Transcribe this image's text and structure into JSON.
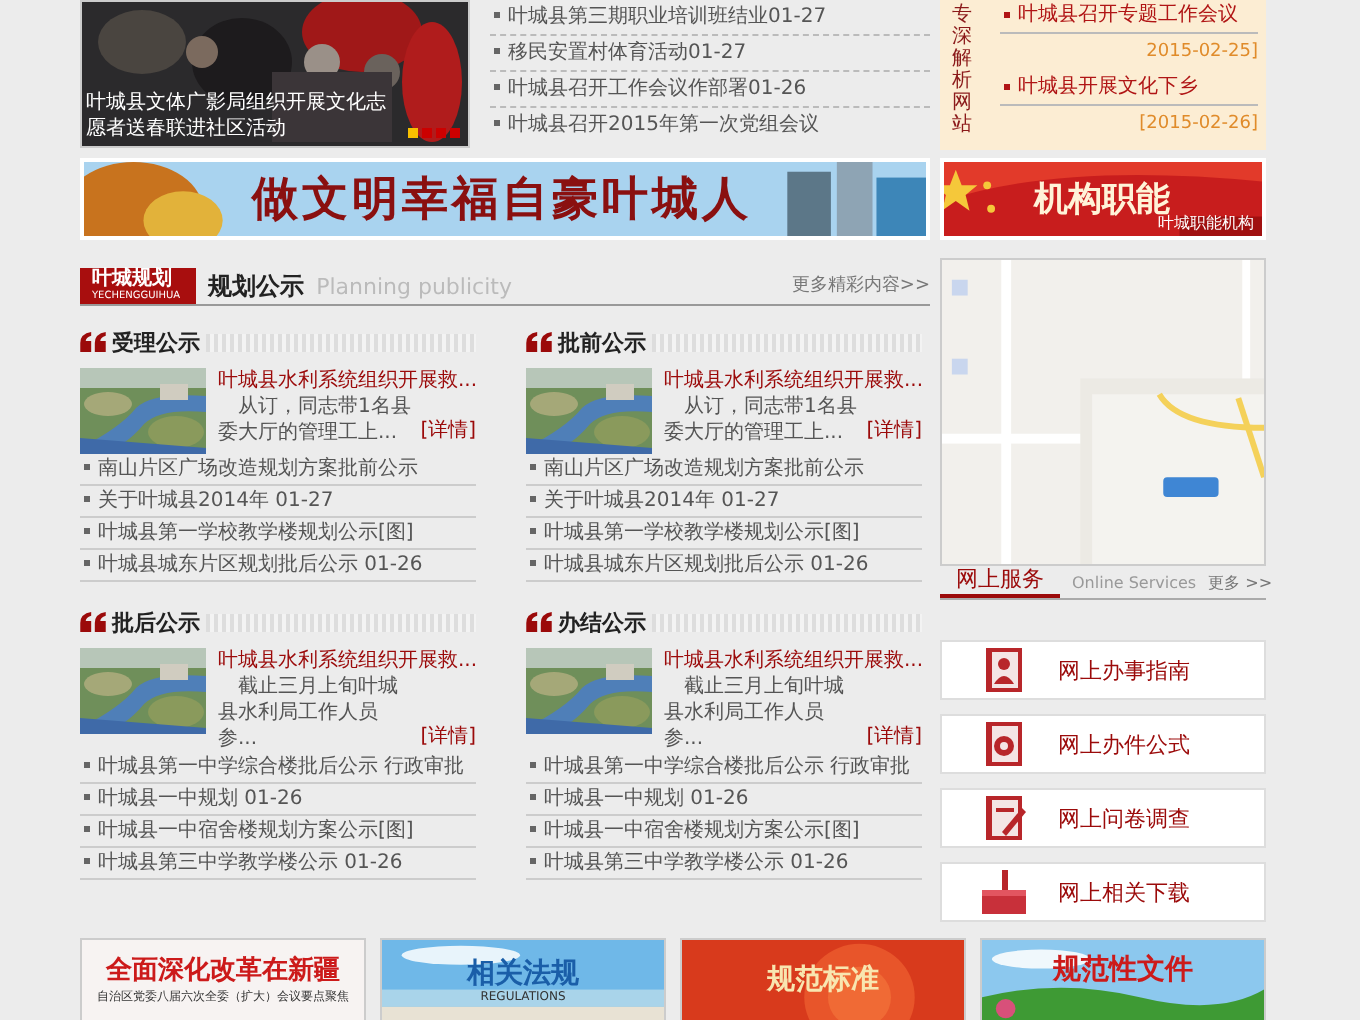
{
  "slideshow": {
    "caption": "叶城县文体广影局组织开展文化志愿者送春联进社区活动",
    "dots": [
      {
        "selected": true
      },
      {
        "selected": false
      },
      {
        "selected": false
      },
      {
        "selected": false
      }
    ]
  },
  "top_news": [
    {
      "title": "叶城县第三期职业培训班结业",
      "date": "01-27"
    },
    {
      "title": "移民安置村体育活动",
      "date": "01-27"
    },
    {
      "title": "叶城县召开工作会议作部署",
      "date": "01-26"
    },
    {
      "title": "叶城县召开2015年第一次党组会议"
    }
  ],
  "side_notice": {
    "vertical_title": "专深解析网站",
    "items": [
      {
        "title": "叶城县召开专题工作会议",
        "date": "2015-02-25]"
      },
      {
        "title": "叶城县开展文化下乡",
        "date": "[2015-02-26]"
      }
    ]
  },
  "banners": [
    {
      "kind": "civic",
      "text": "做文明幸福自豪叶城人"
    },
    {
      "kind": "flag",
      "text": "机构职能",
      "subtext": "叶城职能机构"
    }
  ],
  "section": {
    "tag": "叶城规划",
    "tag_sub": "YECHENGGUIHUA",
    "title": "规划公示",
    "subtitle": "Planning publicity",
    "more": "更多精彩内容>>"
  },
  "blocks": [
    {
      "title": "受理公示",
      "headline": "叶城县水利系统组织开展救...",
      "summary": "从订，同志带1名县委大厅的管理工上...",
      "detail": "[详情]",
      "items": [
        "南山片区广场改造规划方案批前公示",
        "关于叶城县2014年 01-27",
        "叶城县第一学校教学楼规划公示[图]",
        "叶城县城东片区规划批后公示 01-26"
      ]
    },
    {
      "title": "批前公示",
      "headline": "叶城县水利系统组织开展救...",
      "summary": "从订，同志带1名县委大厅的管理工上...",
      "detail": "[详情]",
      "items": [
        "南山片区广场改造规划方案批前公示",
        "关于叶城县2014年 01-27",
        "叶城县第一学校教学楼规划公示[图]",
        "叶城县城东片区规划批后公示 01-26"
      ]
    },
    {
      "title": "批后公示",
      "headline": "叶城县水利系统组织开展救...",
      "summary": "截止三月上旬叶城县水利局工作人员参...",
      "detail": "[详情]",
      "items": [
        "叶城县第一中学综合楼批后公示 行政审批",
        "叶城县一中规划 01-26",
        "叶城县一中宿舍楼规划方案公示[图]",
        "叶城县第三中学教学楼公示 01-26"
      ]
    },
    {
      "title": "办结公示",
      "headline": "叶城县水利系统组织开展救...",
      "summary": "截止三月上旬叶城县水利局工作人员参...",
      "detail": "[详情]",
      "items": [
        "叶城县第一中学综合楼批后公示 行政审批",
        "叶城县一中规划 01-26",
        "叶城县一中宿舍楼规划方案公示[图]",
        "叶城县第三中学教学楼公示 01-26"
      ]
    }
  ],
  "services": {
    "tabs": [
      {
        "label": "网上服务",
        "selected": true
      },
      {
        "label": "Online Services",
        "selected": false
      }
    ],
    "more": "更多 >>",
    "items": [
      {
        "label": "网上办事指南"
      },
      {
        "label": "网上办件公式"
      },
      {
        "label": "网上问卷调查"
      },
      {
        "label": "网上相关下载"
      }
    ]
  },
  "bottom_banners": [
    {
      "kind": "reform",
      "text": "全面深化改革在新疆",
      "subtext": "自治区党委八届六次全委（扩大）会议要点聚焦"
    },
    {
      "kind": "sea",
      "text": "相关法规",
      "subtext": "REGULATIONS"
    },
    {
      "kind": "red",
      "text": "规范标准"
    },
    {
      "kind": "meadow",
      "text": "规范性文件"
    }
  ]
}
